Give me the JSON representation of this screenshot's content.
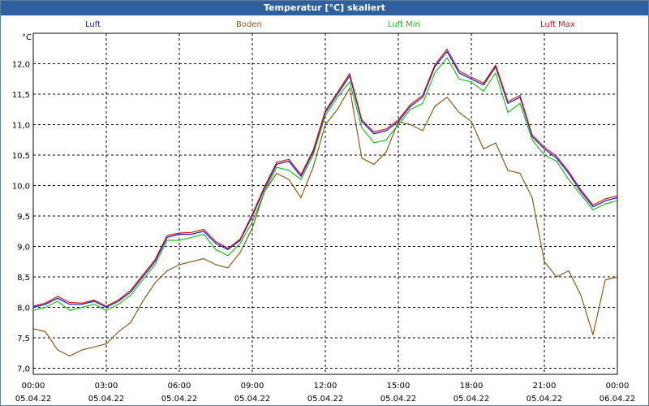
{
  "window": {
    "title": "Temperatur [°C] skaliert"
  },
  "colors": {
    "luft": "#1a1acc",
    "boden": "#8b5a1a",
    "luft_min": "#22bb22",
    "luft_max": "#cc1a1a",
    "grid": "#000000",
    "title_bg": "#2f5f9e"
  },
  "chart_data": {
    "type": "line",
    "title": "Temperatur [°C] skaliert",
    "ylabel": "°C",
    "ylim": [
      6.9,
      12.5
    ],
    "y_ticks": [
      "7,0",
      "7,5",
      "8,0",
      "8,5",
      "9,0",
      "9,5",
      "10,0",
      "10,5",
      "11,0",
      "11,5",
      "12,0"
    ],
    "y_tick_values": [
      7.0,
      7.5,
      8.0,
      8.5,
      9.0,
      9.5,
      10.0,
      10.5,
      11.0,
      11.5,
      12.0
    ],
    "x_ticks": [
      {
        "time": "00:00",
        "date": "05.04.22"
      },
      {
        "time": "03:00",
        "date": "05.04.22"
      },
      {
        "time": "06:00",
        "date": "05.04.22"
      },
      {
        "time": "09:00",
        "date": "05.04.22"
      },
      {
        "time": "12:00",
        "date": "05.04.22"
      },
      {
        "time": "15:00",
        "date": "05.04.22"
      },
      {
        "time": "18:00",
        "date": "05.04.22"
      },
      {
        "time": "21:00",
        "date": "05.04.22"
      },
      {
        "time": "00:00",
        "date": "06.04.22"
      }
    ],
    "grid": true,
    "legend_placement": "top",
    "x_hours": [
      0,
      0.5,
      1,
      1.5,
      2,
      2.5,
      3,
      3.5,
      4,
      4.5,
      5,
      5.5,
      6,
      6.5,
      7,
      7.5,
      8,
      8.5,
      9,
      9.5,
      10,
      10.5,
      11,
      11.5,
      12,
      12.5,
      13,
      13.5,
      14,
      14.5,
      15,
      15.5,
      16,
      16.5,
      17,
      17.5,
      18,
      18.5,
      19,
      19.5,
      20,
      20.5,
      21,
      21.5,
      22,
      22.5,
      23,
      23.5,
      24
    ],
    "series": [
      {
        "name": "Luft",
        "color_key": "luft",
        "values": [
          8.0,
          8.05,
          8.15,
          8.05,
          8.05,
          8.1,
          8.0,
          8.1,
          8.25,
          8.5,
          8.75,
          9.15,
          9.2,
          9.2,
          9.25,
          9.05,
          8.95,
          9.1,
          9.5,
          9.95,
          10.35,
          10.4,
          10.15,
          10.55,
          11.2,
          11.5,
          11.8,
          11.05,
          10.85,
          10.9,
          11.05,
          11.3,
          11.45,
          11.95,
          12.2,
          11.85,
          11.75,
          11.65,
          11.95,
          11.35,
          11.45,
          10.8,
          10.6,
          10.45,
          10.2,
          9.9,
          9.65,
          9.75,
          9.8
        ]
      },
      {
        "name": "Boden",
        "color_key": "boden",
        "values": [
          7.65,
          7.6,
          7.3,
          7.2,
          7.3,
          7.35,
          7.4,
          7.6,
          7.75,
          8.1,
          8.4,
          8.6,
          8.7,
          8.75,
          8.8,
          8.7,
          8.65,
          8.9,
          9.3,
          9.9,
          10.2,
          10.1,
          9.8,
          10.3,
          11.0,
          11.25,
          11.6,
          10.45,
          10.35,
          10.55,
          11.05,
          11.0,
          10.9,
          11.3,
          11.45,
          11.2,
          11.05,
          10.6,
          10.7,
          10.25,
          10.2,
          9.8,
          8.75,
          8.5,
          8.6,
          8.2,
          7.55,
          8.45,
          8.5
        ]
      },
      {
        "name": "Luft Min",
        "color_key": "luft_min",
        "values": [
          7.95,
          8.0,
          8.1,
          7.95,
          8.0,
          8.05,
          7.95,
          8.05,
          8.2,
          8.45,
          8.7,
          9.1,
          9.1,
          9.15,
          9.2,
          8.95,
          8.85,
          9.05,
          9.4,
          9.9,
          10.3,
          10.25,
          10.1,
          10.5,
          11.15,
          11.45,
          11.7,
          10.95,
          10.7,
          10.75,
          11.0,
          11.25,
          11.35,
          11.85,
          12.1,
          11.75,
          11.7,
          11.55,
          11.85,
          11.2,
          11.35,
          10.75,
          10.5,
          10.4,
          10.1,
          9.85,
          9.6,
          9.7,
          9.75
        ]
      },
      {
        "name": "Luft Max",
        "color_key": "luft_max",
        "values": [
          8.02,
          8.07,
          8.18,
          8.08,
          8.07,
          8.12,
          8.02,
          8.12,
          8.28,
          8.53,
          8.78,
          9.18,
          9.22,
          9.23,
          9.28,
          9.08,
          8.97,
          9.12,
          9.53,
          9.98,
          10.38,
          10.43,
          10.18,
          10.58,
          11.23,
          11.53,
          11.84,
          11.08,
          10.88,
          10.93,
          11.08,
          11.33,
          11.48,
          11.98,
          12.24,
          11.88,
          11.78,
          11.68,
          11.98,
          11.38,
          11.48,
          10.83,
          10.63,
          10.48,
          10.23,
          9.93,
          9.68,
          9.78,
          9.83
        ]
      }
    ]
  }
}
